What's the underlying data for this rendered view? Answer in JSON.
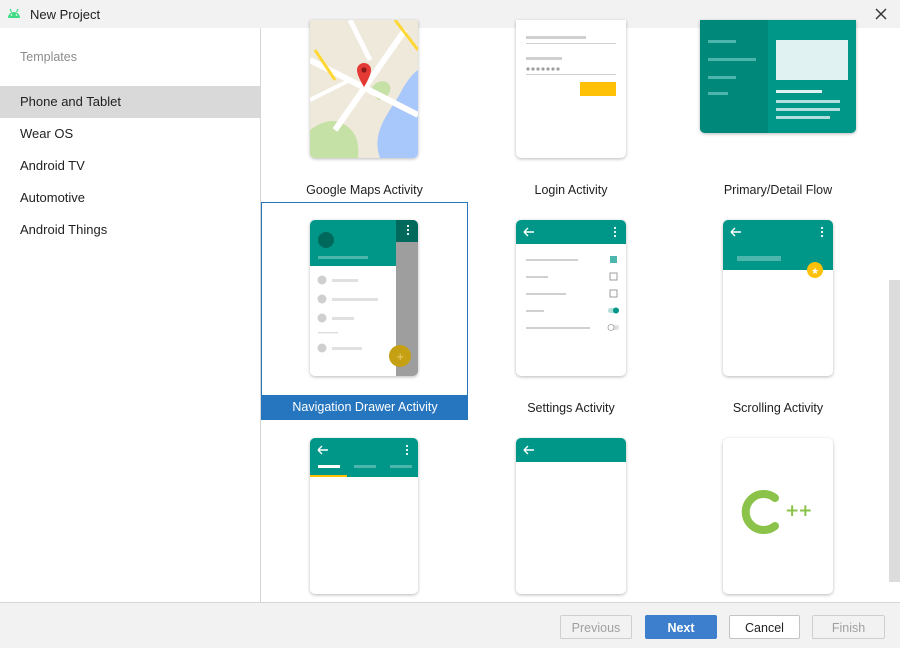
{
  "window": {
    "title": "New Project"
  },
  "sidebar": {
    "heading": "Templates",
    "items": [
      {
        "label": "Phone and Tablet",
        "selected": true
      },
      {
        "label": "Wear OS"
      },
      {
        "label": "Android TV"
      },
      {
        "label": "Automotive"
      },
      {
        "label": "Android Things"
      }
    ]
  },
  "templates": [
    {
      "label": "Google Maps Activity"
    },
    {
      "label": "Login Activity"
    },
    {
      "label": "Primary/Detail Flow"
    },
    {
      "label": "Navigation Drawer Activity",
      "selected": true
    },
    {
      "label": "Settings Activity"
    },
    {
      "label": "Scrolling Activity"
    },
    {
      "label": ""
    },
    {
      "label": ""
    },
    {
      "label": ""
    }
  ],
  "colors": {
    "teal": "#009688",
    "accent": "#ffc107",
    "selection": "#2675bf",
    "cpp": "#8bc34a"
  },
  "cpp_glyph": "++",
  "buttons": {
    "previous": "Previous",
    "next": "Next",
    "cancel": "Cancel",
    "finish": "Finish"
  }
}
